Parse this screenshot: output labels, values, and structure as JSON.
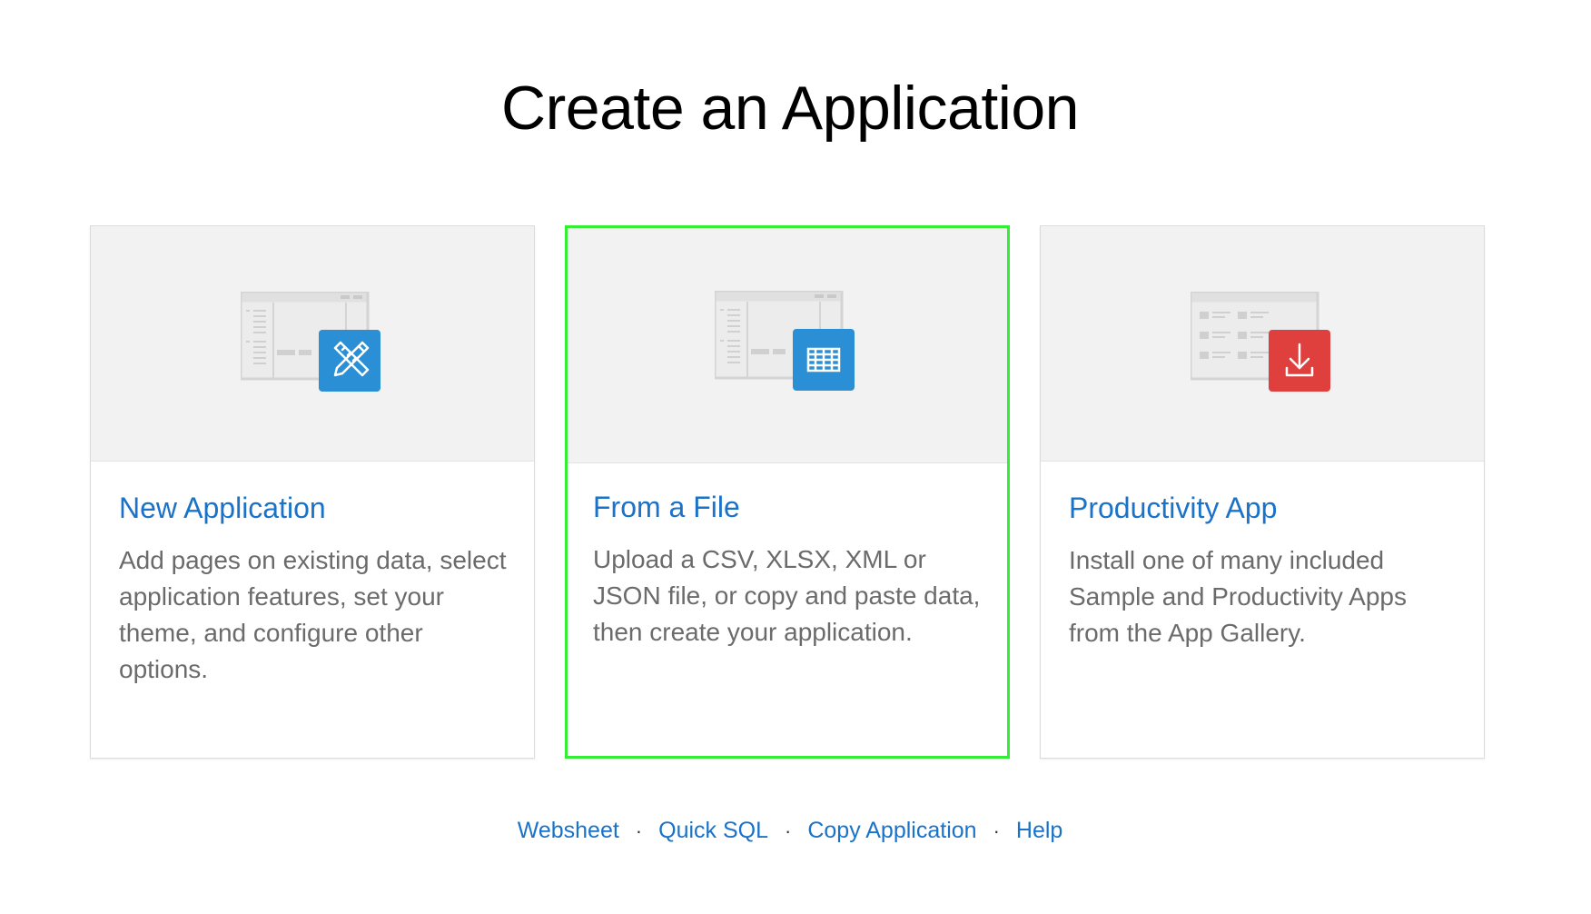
{
  "page": {
    "title": "Create an Application"
  },
  "cards": [
    {
      "title": "New Application",
      "description": "Add pages on existing data, select application features, set your theme, and configure other options.",
      "icon": "pencil-ruler-icon",
      "badge_color": "#2a8fd4"
    },
    {
      "title": "From a File",
      "description": "Upload a CSV, XLSX, XML or JSON file, or copy and paste data, then create your application.",
      "icon": "table-grid-icon",
      "badge_color": "#2a8fd4",
      "selected": true
    },
    {
      "title": "Productivity App",
      "description": "Install one of many included Sample and Productivity Apps from the App Gallery.",
      "icon": "download-icon",
      "badge_color": "#e0403d"
    }
  ],
  "footer": {
    "links": [
      "Websheet",
      "Quick SQL",
      "Copy Application",
      "Help"
    ],
    "separator": "·"
  },
  "colors": {
    "link": "#1a73c8",
    "selection_outline": "#33ee33",
    "hero_background": "#f2f2f2"
  }
}
